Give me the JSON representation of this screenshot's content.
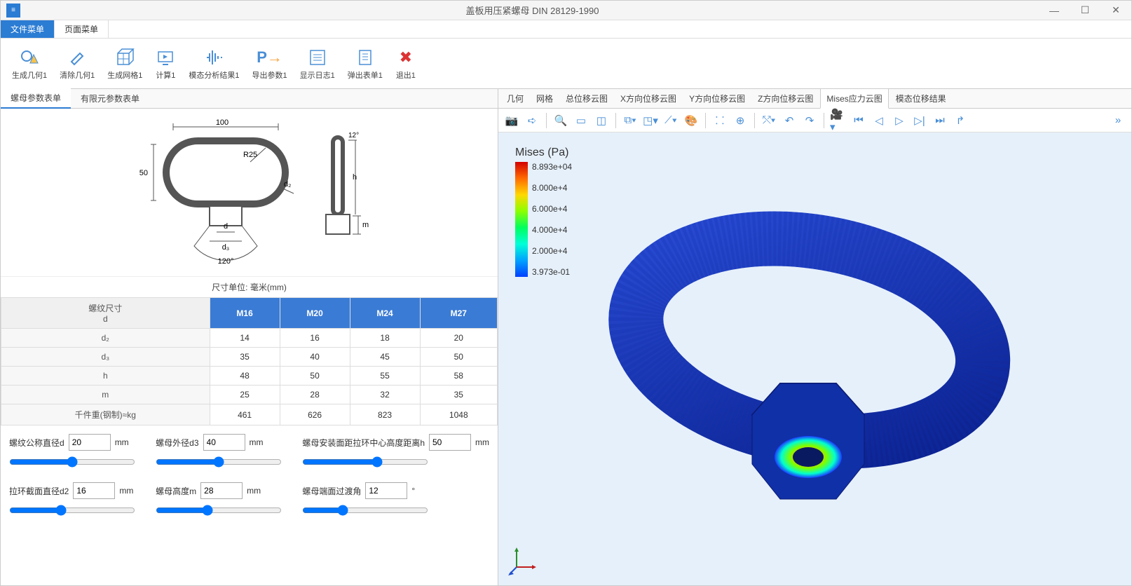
{
  "title": "盖板用压紧螺母 DIN 28129-1990",
  "menu_tabs": {
    "file": "文件菜单",
    "page": "页面菜单"
  },
  "toolbar": [
    {
      "id": "gen-geom",
      "label": "生成几何1",
      "icon": "◯△"
    },
    {
      "id": "clear-geom",
      "label": "清除几何1",
      "icon": "🧹"
    },
    {
      "id": "gen-mesh",
      "label": "生成网格1",
      "icon": "▦"
    },
    {
      "id": "compute",
      "label": "计算1",
      "icon": "▶"
    },
    {
      "id": "modal-result",
      "label": "模态分析结果1",
      "icon": "⫴"
    },
    {
      "id": "export",
      "label": "导出参数1",
      "icon": "P→"
    },
    {
      "id": "show-log",
      "label": "显示日志1",
      "icon": "▤"
    },
    {
      "id": "popup-form",
      "label": "弹出表单1",
      "icon": "📄"
    },
    {
      "id": "exit",
      "label": "退出1",
      "icon": "✖"
    }
  ],
  "left_tabs": [
    "螺母参数表单",
    "有限元参数表单"
  ],
  "unit_label": "尺寸单位: 毫米(mm)",
  "spec": {
    "head": [
      "螺纹尺寸\nd",
      "M16",
      "M20",
      "M24",
      "M27"
    ],
    "rows": [
      {
        "k": "d₂",
        "v": [
          "14",
          "16",
          "18",
          "20"
        ]
      },
      {
        "k": "d₃",
        "v": [
          "35",
          "40",
          "45",
          "50"
        ]
      },
      {
        "k": "h",
        "v": [
          "48",
          "50",
          "55",
          "58"
        ]
      },
      {
        "k": "m",
        "v": [
          "25",
          "28",
          "32",
          "35"
        ]
      },
      {
        "k": "千件重(钢制)≈kg",
        "v": [
          "461",
          "626",
          "823",
          "1048"
        ]
      }
    ]
  },
  "params": [
    {
      "id": "d",
      "label": "螺纹公称直径d",
      "value": "20",
      "unit": "mm"
    },
    {
      "id": "d3",
      "label": "螺母外径d3",
      "value": "40",
      "unit": "mm"
    },
    {
      "id": "h",
      "label": "螺母安装面距拉环中心高度距离h",
      "value": "50",
      "unit": "mm"
    },
    {
      "id": "d2",
      "label": "拉环截面直径d2",
      "value": "16",
      "unit": "mm"
    },
    {
      "id": "m",
      "label": "螺母高度m",
      "value": "28",
      "unit": "mm"
    },
    {
      "id": "angle",
      "label": "螺母端面过渡角",
      "value": "12",
      "unit": "°"
    }
  ],
  "view_tabs": [
    "几何",
    "网格",
    "总位移云图",
    "X方向位移云图",
    "Y方向位移云图",
    "Z方向位移云图",
    "Mises应力云图",
    "模态位移结果"
  ],
  "legend": {
    "title": "Mises (Pa)",
    "values": [
      "8.893e+04",
      "8.000e+4",
      "6.000e+4",
      "4.000e+4",
      "2.000e+4",
      "3.973e-01"
    ]
  },
  "diagram_annot": {
    "w": "100",
    "h50": "50",
    "r": "R25",
    "d2l": "d₂",
    "ang12": "12°",
    "d": "d",
    "d3": "d₃",
    "ang120": "120°",
    "m": "m",
    "hlabel": "h"
  }
}
